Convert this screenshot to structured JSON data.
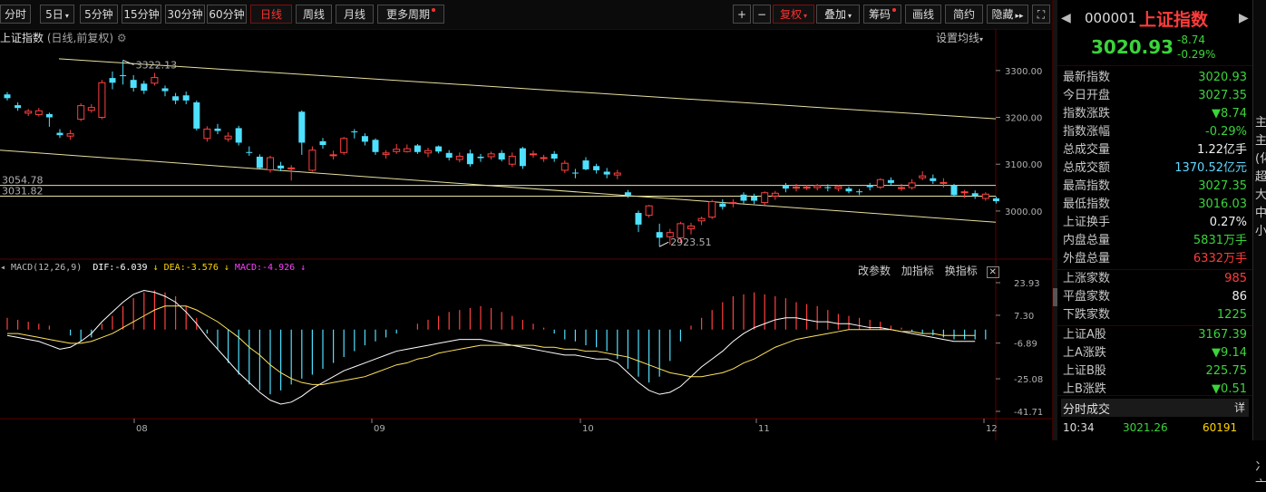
{
  "toolbar": {
    "periods": [
      "分时",
      "5日",
      "5分钟",
      "15分钟",
      "30分钟",
      "60分钟",
      "日线",
      "周线",
      "月线",
      "更多周期"
    ],
    "active": "日线",
    "right_tools": [
      "+",
      "−",
      "复权",
      "叠加",
      "筹码",
      "画线",
      "简约",
      "隐藏"
    ]
  },
  "chart_header": {
    "title": "上证指数",
    "subtitle": "(日线,前复权)",
    "settings": "设置均线"
  },
  "chart_data": {
    "type": "candlestick",
    "y_ticks": [
      3300.0,
      3200.0,
      3100.0,
      3000.0
    ],
    "ylim": [
      2905,
      3350
    ],
    "month_labels": [
      "08",
      "09",
      "10",
      "11",
      "12"
    ],
    "high_label": "3322.13",
    "low_label": "2923.51",
    "line_labels": [
      "3054.78",
      "3031.82"
    ],
    "horizontal_levels": [
      3054.78,
      3031.82
    ],
    "channel_upper": [
      [
        0,
        3325
      ],
      [
        62,
        3197
      ]
    ],
    "channel_lower": [
      [
        0,
        3130
      ],
      [
        62,
        2976
      ]
    ],
    "candles": [
      [
        3249,
        3241,
        3254,
        3236
      ],
      [
        3226,
        3220,
        3232,
        3214
      ],
      [
        3209,
        3213,
        3218,
        3203
      ],
      [
        3206,
        3214,
        3220,
        3202
      ],
      [
        3207,
        3200,
        3210,
        3180
      ],
      [
        3167,
        3162,
        3175,
        3156
      ],
      [
        3160,
        3165,
        3173,
        3152
      ],
      [
        3196,
        3225,
        3230,
        3192
      ],
      [
        3215,
        3221,
        3228,
        3210
      ],
      [
        3200,
        3274,
        3280,
        3196
      ],
      [
        3284,
        3274,
        3298,
        3260
      ],
      [
        3290,
        3288,
        3322,
        3270
      ],
      [
        3280,
        3263,
        3290,
        3255
      ],
      [
        3272,
        3257,
        3278,
        3250
      ],
      [
        3273,
        3285,
        3295,
        3268
      ],
      [
        3262,
        3256,
        3268,
        3245
      ],
      [
        3245,
        3236,
        3252,
        3228
      ],
      [
        3247,
        3236,
        3255,
        3228
      ],
      [
        3232,
        3176,
        3236,
        3172
      ],
      [
        3155,
        3175,
        3181,
        3148
      ],
      [
        3176,
        3171,
        3186,
        3164
      ],
      [
        3154,
        3160,
        3168,
        3148
      ],
      [
        3177,
        3146,
        3182,
        3140
      ],
      [
        3126,
        3125,
        3138,
        3118
      ],
      [
        3116,
        3092,
        3121,
        3089
      ],
      [
        3088,
        3114,
        3118,
        3082
      ],
      [
        3097,
        3091,
        3105,
        3085
      ],
      [
        3091,
        3092,
        3098,
        3065
      ],
      [
        3212,
        3146,
        3215,
        3120
      ],
      [
        3087,
        3130,
        3138,
        3084
      ],
      [
        3149,
        3141,
        3156,
        3133
      ],
      [
        3120,
        3120,
        3129,
        3110
      ],
      [
        3125,
        3155,
        3158,
        3120
      ],
      [
        3170,
        3168,
        3175,
        3155
      ],
      [
        3160,
        3148,
        3166,
        3140
      ],
      [
        3152,
        3126,
        3155,
        3120
      ],
      [
        3121,
        3124,
        3130,
        3112
      ],
      [
        3127,
        3132,
        3143,
        3122
      ],
      [
        3127,
        3133,
        3142,
        3125
      ],
      [
        3140,
        3126,
        3143,
        3122
      ],
      [
        3124,
        3129,
        3135,
        3115
      ],
      [
        3138,
        3127,
        3140,
        3123
      ],
      [
        3124,
        3114,
        3130,
        3108
      ],
      [
        3110,
        3117,
        3125,
        3104
      ],
      [
        3123,
        3100,
        3131,
        3095
      ],
      [
        3116,
        3113,
        3122,
        3105
      ],
      [
        3116,
        3122,
        3127,
        3110
      ],
      [
        3124,
        3110,
        3130,
        3106
      ],
      [
        3100,
        3117,
        3125,
        3094
      ],
      [
        3134,
        3096,
        3137,
        3090
      ],
      [
        3121,
        3122,
        3129,
        3114
      ],
      [
        3113,
        3114,
        3120,
        3105
      ],
      [
        3122,
        3112,
        3128,
        3105
      ],
      [
        3087,
        3102,
        3108,
        3081
      ],
      [
        3082,
        3080,
        3090,
        3070
      ],
      [
        3108,
        3089,
        3115,
        3087
      ],
      [
        3096,
        3087,
        3101,
        3080
      ],
      [
        3084,
        3078,
        3092,
        3070
      ],
      [
        3077,
        3081,
        3088,
        3068
      ],
      [
        3040,
        3034,
        3045,
        3028
      ],
      [
        2996,
        2971,
        3001,
        2955
      ],
      [
        2991,
        3011,
        3013,
        2986
      ],
      [
        2955,
        2943,
        2973,
        2924
      ],
      [
        2945,
        2954,
        2962,
        2928
      ],
      [
        2943,
        2973,
        2977,
        2932
      ],
      [
        2962,
        2968,
        2975,
        2950
      ],
      [
        2979,
        2984,
        2988,
        2970
      ],
      [
        2987,
        3020,
        3024,
        2983
      ],
      [
        3016,
        3009,
        3025,
        3003
      ],
      [
        3017,
        3018,
        3025,
        3008
      ],
      [
        3035,
        3022,
        3040,
        3016
      ],
      [
        3031,
        3022,
        3037,
        3015
      ],
      [
        3018,
        3039,
        3042,
        3013
      ],
      [
        3032,
        3038,
        3043,
        3024
      ],
      [
        3054,
        3048,
        3060,
        3040
      ],
      [
        3049,
        3051,
        3058,
        3042
      ],
      [
        3050,
        3051,
        3056,
        3045
      ],
      [
        3050,
        3054,
        3058,
        3044
      ],
      [
        3051,
        3049,
        3057,
        3042
      ],
      [
        3048,
        3052,
        3056,
        3042
      ],
      [
        3048,
        3042,
        3052,
        3038
      ],
      [
        3042,
        3041,
        3047,
        3034
      ],
      [
        3054,
        3051,
        3060,
        3044
      ],
      [
        3051,
        3067,
        3070,
        3047
      ],
      [
        3066,
        3060,
        3072,
        3056
      ],
      [
        3050,
        3050,
        3058,
        3043
      ],
      [
        3050,
        3060,
        3068,
        3046
      ],
      [
        3071,
        3075,
        3085,
        3066
      ],
      [
        3070,
        3064,
        3078,
        3058
      ],
      [
        3059,
        3061,
        3070,
        3050
      ],
      [
        3054,
        3034,
        3058,
        3030
      ],
      [
        3040,
        3041,
        3045,
        3028
      ],
      [
        3038,
        3032,
        3044,
        3026
      ],
      [
        3027,
        3036,
        3040,
        3022
      ],
      [
        3027,
        3021,
        3031,
        3016
      ]
    ],
    "macd": {
      "label": "MACD(12,26,9)",
      "dif": "DIF:-6.039",
      "dea": "DEA:-3.576",
      "macd": "MACD:-4.926",
      "y_ticks": [
        23.93,
        7.3,
        -6.89,
        -25.08,
        -41.71
      ],
      "ylim": [
        -41.71,
        23.93
      ],
      "hist": [
        6,
        5,
        4,
        3,
        2,
        0,
        -3,
        -6,
        -4,
        3,
        7,
        12,
        16,
        19,
        20,
        19,
        17,
        12,
        6,
        -2,
        -10,
        -17,
        -23,
        -28,
        -31,
        -33,
        -31,
        -28,
        -25,
        -23,
        -20,
        -17,
        -14,
        -11,
        -8,
        -6,
        -4,
        -2,
        0,
        3,
        5,
        7,
        9,
        10,
        11,
        12,
        11,
        9,
        7,
        5,
        3,
        1,
        -2,
        -5,
        -6,
        -8,
        -9,
        -11,
        -15,
        -20,
        -24,
        -27,
        -24,
        -16,
        -6,
        2,
        6,
        10,
        14,
        17,
        18,
        19,
        18,
        17,
        16,
        14,
        13,
        12,
        10,
        8,
        7,
        6,
        5,
        4,
        2,
        1,
        -1,
        -2,
        -3,
        -4,
        -5,
        -5,
        -5,
        -5
      ],
      "dif_line": [
        -3,
        -4,
        -5,
        -6,
        -8,
        -10,
        -9,
        -6,
        -2,
        4,
        9,
        14,
        18,
        20,
        19,
        17,
        14,
        9,
        3,
        -4,
        -10,
        -16,
        -22,
        -27,
        -32,
        -36,
        -38,
        -37,
        -34,
        -30,
        -27,
        -24,
        -21,
        -19,
        -17,
        -15,
        -13,
        -11,
        -10,
        -9,
        -8,
        -7,
        -6,
        -5,
        -5,
        -5,
        -6,
        -7,
        -8,
        -9,
        -10,
        -11,
        -12,
        -13,
        -13,
        -14,
        -15,
        -15,
        -17,
        -22,
        -27,
        -31,
        -33,
        -32,
        -29,
        -24,
        -19,
        -15,
        -11,
        -6,
        -2,
        1,
        3,
        5,
        6,
        6,
        5,
        4,
        4,
        3,
        3,
        2,
        1,
        1,
        0,
        -1,
        -2,
        -3,
        -4,
        -5,
        -6,
        -6,
        -6
      ],
      "dea_line": [
        -2,
        -2,
        -3,
        -4,
        -5,
        -6,
        -7,
        -7,
        -6,
        -4,
        -2,
        1,
        4,
        7,
        10,
        12,
        12,
        12,
        10,
        7,
        4,
        0,
        -4,
        -9,
        -13,
        -18,
        -22,
        -25,
        -27,
        -28,
        -28,
        -27,
        -26,
        -25,
        -24,
        -22,
        -20,
        -18,
        -17,
        -15,
        -14,
        -12,
        -11,
        -10,
        -9,
        -8,
        -8,
        -8,
        -8,
        -8,
        -8,
        -9,
        -9,
        -10,
        -10,
        -11,
        -11,
        -12,
        -13,
        -14,
        -16,
        -18,
        -20,
        -22,
        -23,
        -24,
        -24,
        -23,
        -22,
        -20,
        -17,
        -15,
        -12,
        -9,
        -7,
        -5,
        -4,
        -3,
        -2,
        -1,
        0,
        0,
        0,
        0,
        0,
        -1,
        -1,
        -2,
        -2,
        -3,
        -3,
        -3,
        -3
      ]
    }
  },
  "macd_controls": [
    "改参数",
    "加指标",
    "换指标"
  ],
  "right_panel": {
    "code": "000001",
    "name": "上证指数",
    "price": "3020.93",
    "change": "-8.74",
    "change_pct": "-0.29%",
    "rows": [
      {
        "label": "最新指数",
        "value": "3020.93",
        "color": "green"
      },
      {
        "label": "今日开盘",
        "value": "3027.35",
        "color": "green"
      },
      {
        "label": "指数涨跌",
        "value": "▼8.74",
        "color": "green"
      },
      {
        "label": "指数涨幅",
        "value": "-0.29%",
        "color": "green"
      },
      {
        "label": "总成交量",
        "value": "1.22亿手",
        "color": "white"
      },
      {
        "label": "总成交额",
        "value": "1370.52亿元",
        "color": "cyan"
      },
      {
        "label": "最高指数",
        "value": "3027.35",
        "color": "green"
      },
      {
        "label": "最低指数",
        "value": "3016.03",
        "color": "green"
      },
      {
        "label": "上证换手",
        "value": "0.27%",
        "color": "white"
      },
      {
        "label": "内盘总量",
        "value": "5831万手",
        "color": "green"
      },
      {
        "label": "外盘总量",
        "value": "6332万手",
        "color": "red"
      },
      {
        "label": "上涨家数",
        "value": "985",
        "color": "red"
      },
      {
        "label": "平盘家数",
        "value": "86",
        "color": "white"
      },
      {
        "label": "下跌家数",
        "value": "1225",
        "color": "green"
      },
      {
        "label": "上证A股",
        "value": "3167.39",
        "color": "green"
      },
      {
        "label": "上A涨跌",
        "value": "▼9.14",
        "color": "green"
      },
      {
        "label": "上证B股",
        "value": "225.75",
        "color": "green"
      },
      {
        "label": "上B涨跌",
        "value": "▼0.51",
        "color": "green"
      }
    ],
    "section_title": "分时成交",
    "detail_label": "详",
    "tick": {
      "time": "10:34",
      "price": "3021.26",
      "volume": "60191"
    }
  },
  "edge_chars": [
    "主",
    "主",
    "(化",
    "超",
    "大",
    "中",
    "小",
    "",
    "",
    "",
    "",
    "",
    "",
    "",
    "",
    "",
    "",
    "",
    "",
    "冫",
    "亠"
  ]
}
